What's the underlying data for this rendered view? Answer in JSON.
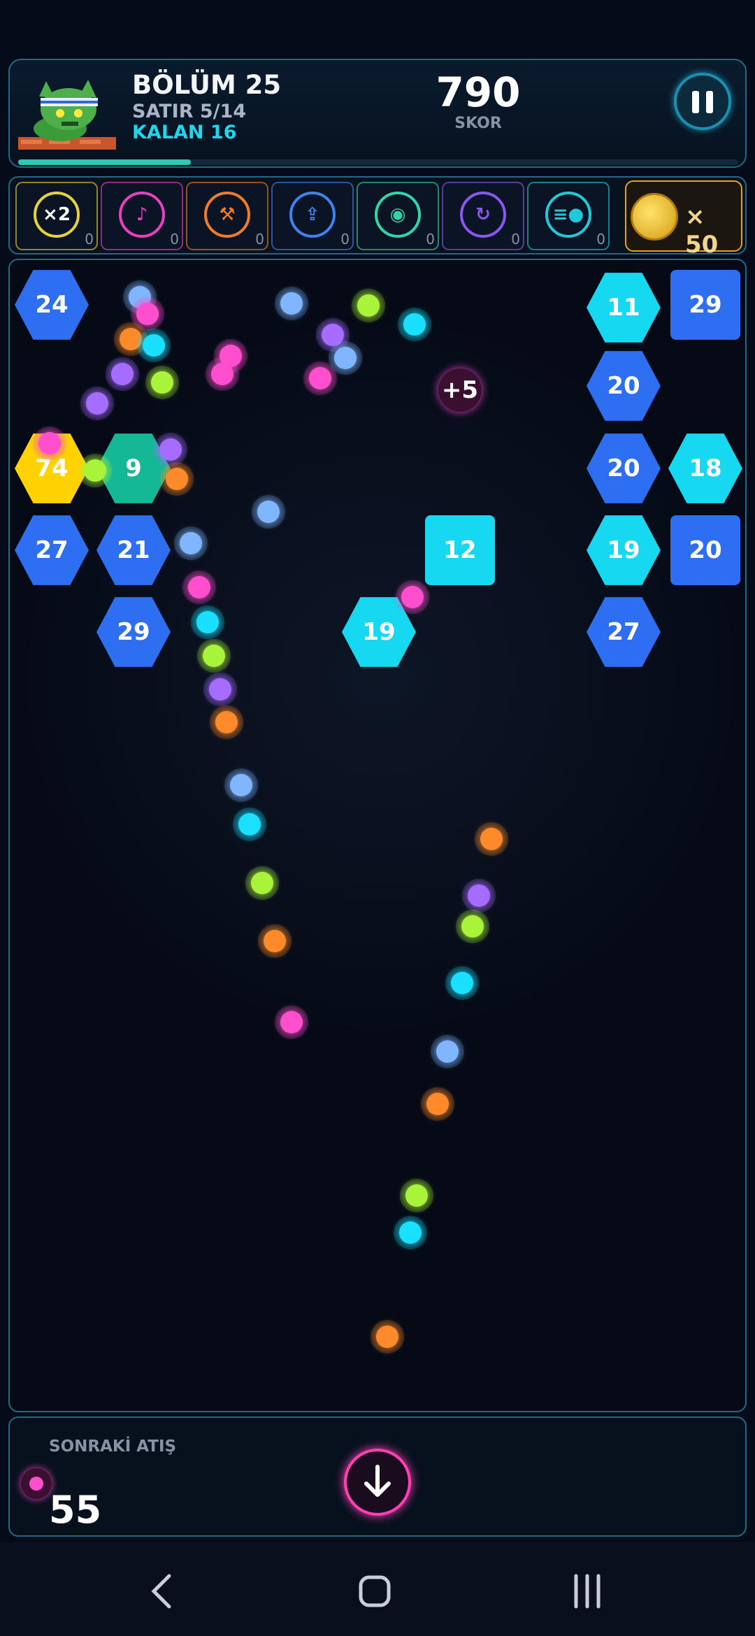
{
  "header": {
    "level_title": "BÖLÜM 25",
    "row_text": "SATIR 5/14",
    "remaining_text": "KALAN 16",
    "score_value": "790",
    "score_label": "SKOR",
    "level_progress": 0.24
  },
  "powerups": [
    {
      "icon": "double-ball-icon",
      "label": "×2",
      "count": "0",
      "color": "#e7d13a"
    },
    {
      "icon": "music-note-icon",
      "label": "",
      "count": "0",
      "color": "#e83fbf"
    },
    {
      "icon": "hammer-icon",
      "label": "",
      "count": "0",
      "color": "#f07c2a"
    },
    {
      "icon": "upload-arrow-icon",
      "label": "",
      "count": "0",
      "color": "#3d82f0"
    },
    {
      "icon": "target-icon",
      "label": "",
      "count": "0",
      "color": "#2fd4a8"
    },
    {
      "icon": "rotate-icon",
      "label": "",
      "count": "0",
      "color": "#8a56f0"
    },
    {
      "icon": "speed-ball-icon",
      "label": "",
      "count": "0",
      "color": "#20c8d8"
    }
  ],
  "coins": {
    "count": "× 50",
    "icon": "coin-icon"
  },
  "blocks": [
    {
      "value": "24",
      "color": "blue",
      "shape": "hex"
    },
    {
      "value": "11",
      "color": "cyan",
      "shape": "hex"
    },
    {
      "value": "29",
      "color": "blue",
      "shape": "square"
    },
    {
      "value": "20",
      "color": "blue",
      "shape": "hex"
    },
    {
      "value": "74",
      "color": "yellow",
      "shape": "hex"
    },
    {
      "value": "9",
      "color": "teal",
      "shape": "hex"
    },
    {
      "value": "20",
      "color": "blue",
      "shape": "hex"
    },
    {
      "value": "18",
      "color": "cyan",
      "shape": "hex"
    },
    {
      "value": "27",
      "color": "blue",
      "shape": "hex"
    },
    {
      "value": "21",
      "color": "blue",
      "shape": "hex"
    },
    {
      "value": "12",
      "color": "cyan",
      "shape": "square"
    },
    {
      "value": "19",
      "color": "cyan",
      "shape": "hex"
    },
    {
      "value": "20",
      "color": "blue",
      "shape": "square"
    },
    {
      "value": "29",
      "color": "blue",
      "shape": "hex"
    },
    {
      "value": "19",
      "color": "cyan",
      "shape": "hex"
    },
    {
      "value": "27",
      "color": "blue",
      "shape": "hex"
    }
  ],
  "bonus": {
    "label": "+5"
  },
  "ball_colors": {
    "pink": "#ff4fcf",
    "orange": "#ff8a2a",
    "cyan": "#19e0ff",
    "lime": "#a8f43a",
    "purple": "#a66cff",
    "lightblue": "#7fb6ff"
  },
  "bottom": {
    "next_shot_label": "SONRAKİ ATIŞ",
    "shots_count": "55",
    "fire_icon": "arrow-down-icon"
  },
  "navbar": {
    "back_icon": "back-icon",
    "home_icon": "home-icon",
    "recents_icon": "recents-icon"
  }
}
